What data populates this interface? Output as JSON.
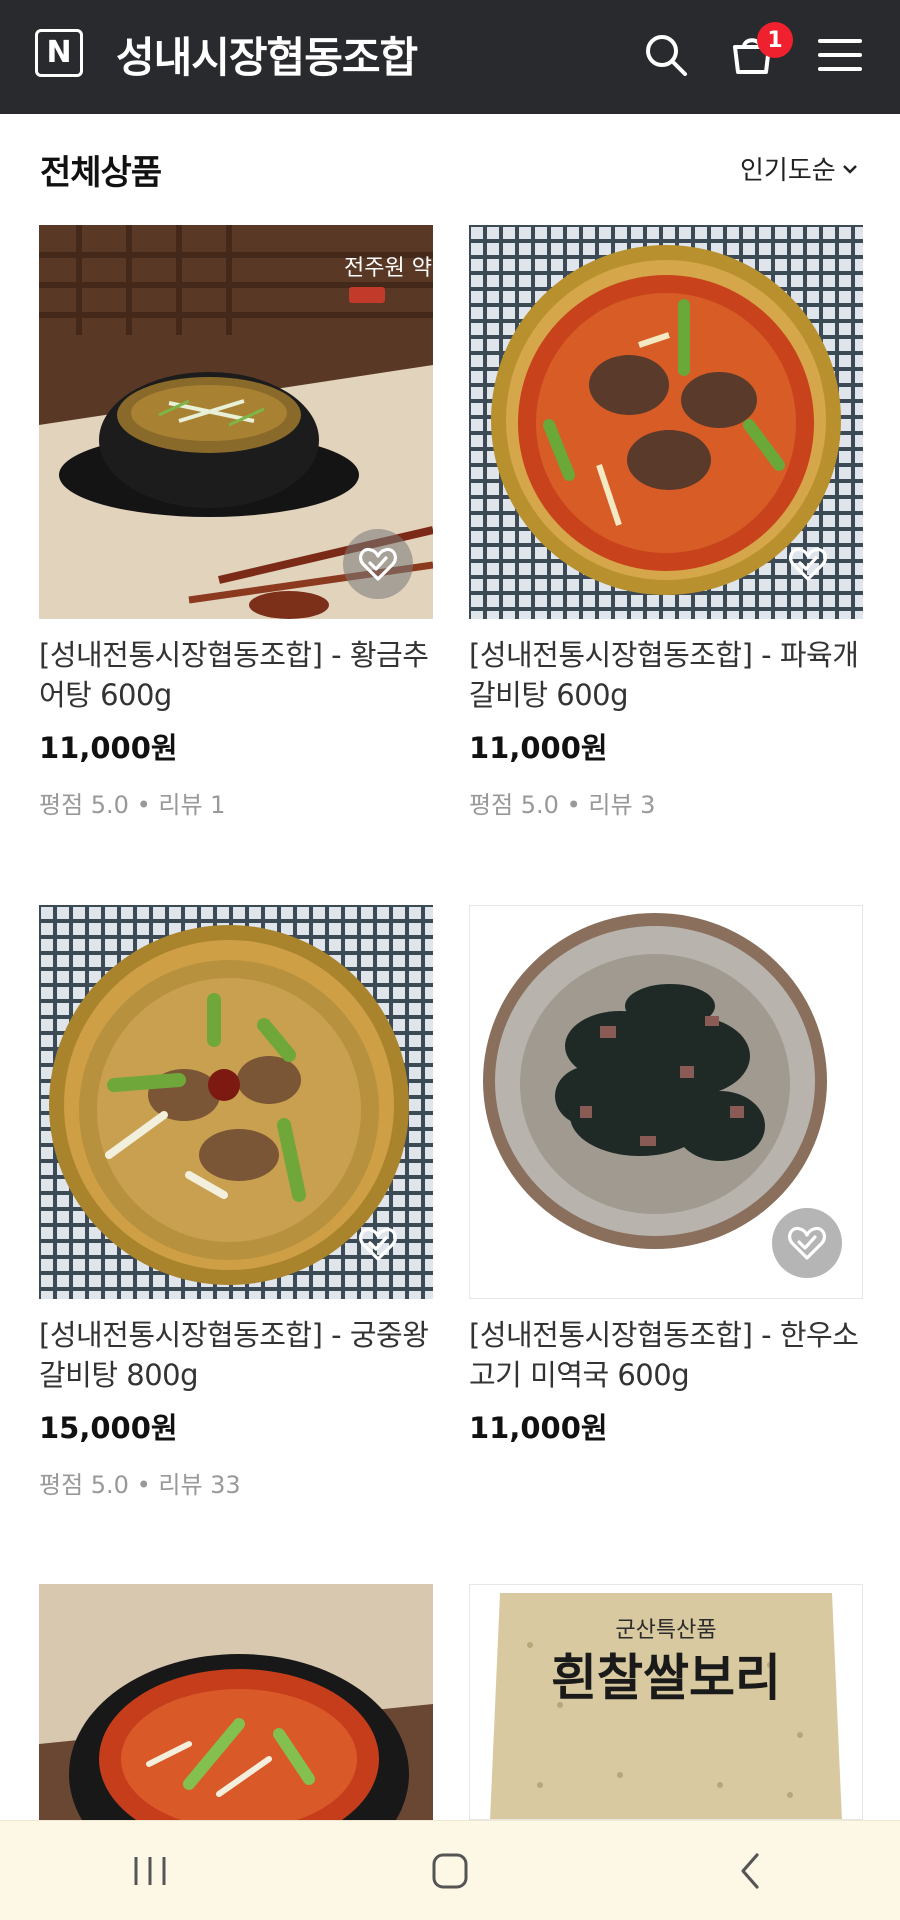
{
  "header": {
    "logo_letter": "N",
    "store_name": "성내시장협동조합",
    "cart_count": "1"
  },
  "section": {
    "title": "전체상품",
    "sort": "인기도순"
  },
  "products": [
    {
      "name": "[성내전통시장협동조합] - 황금추어탕 600g",
      "price": "11,000원",
      "rating": "평점 5.0 • 리뷰 1"
    },
    {
      "name": "[성내전통시장협동조합] - 파육개 갈비탕 600g",
      "price": "11,000원",
      "rating": "평점 5.0 • 리뷰 3"
    },
    {
      "name": "[성내전통시장협동조합] - 궁중왕갈비탕 800g",
      "price": "15,000원",
      "rating": "평점 5.0 • 리뷰 33"
    },
    {
      "name": "[성내전통시장협동조합] - 한우소고기 미역국 600g",
      "price": "11,000원",
      "rating": ""
    }
  ],
  "images": {
    "p1_brand": "전주원 약선요리",
    "p6_label_top": "군산특산품",
    "p6_label_main": "흰찰쌀보리"
  },
  "icons": {
    "search": "search-icon",
    "cart": "cart-icon",
    "menu": "hamburger-menu-icon",
    "wish": "heart-check-icon",
    "nav_recent": "recent-apps-icon",
    "nav_home": "home-icon",
    "nav_back": "back-icon"
  },
  "colors": {
    "header_bg": "#292a2d",
    "badge": "#f0212f",
    "navbar_bg": "#fdf7e6"
  }
}
